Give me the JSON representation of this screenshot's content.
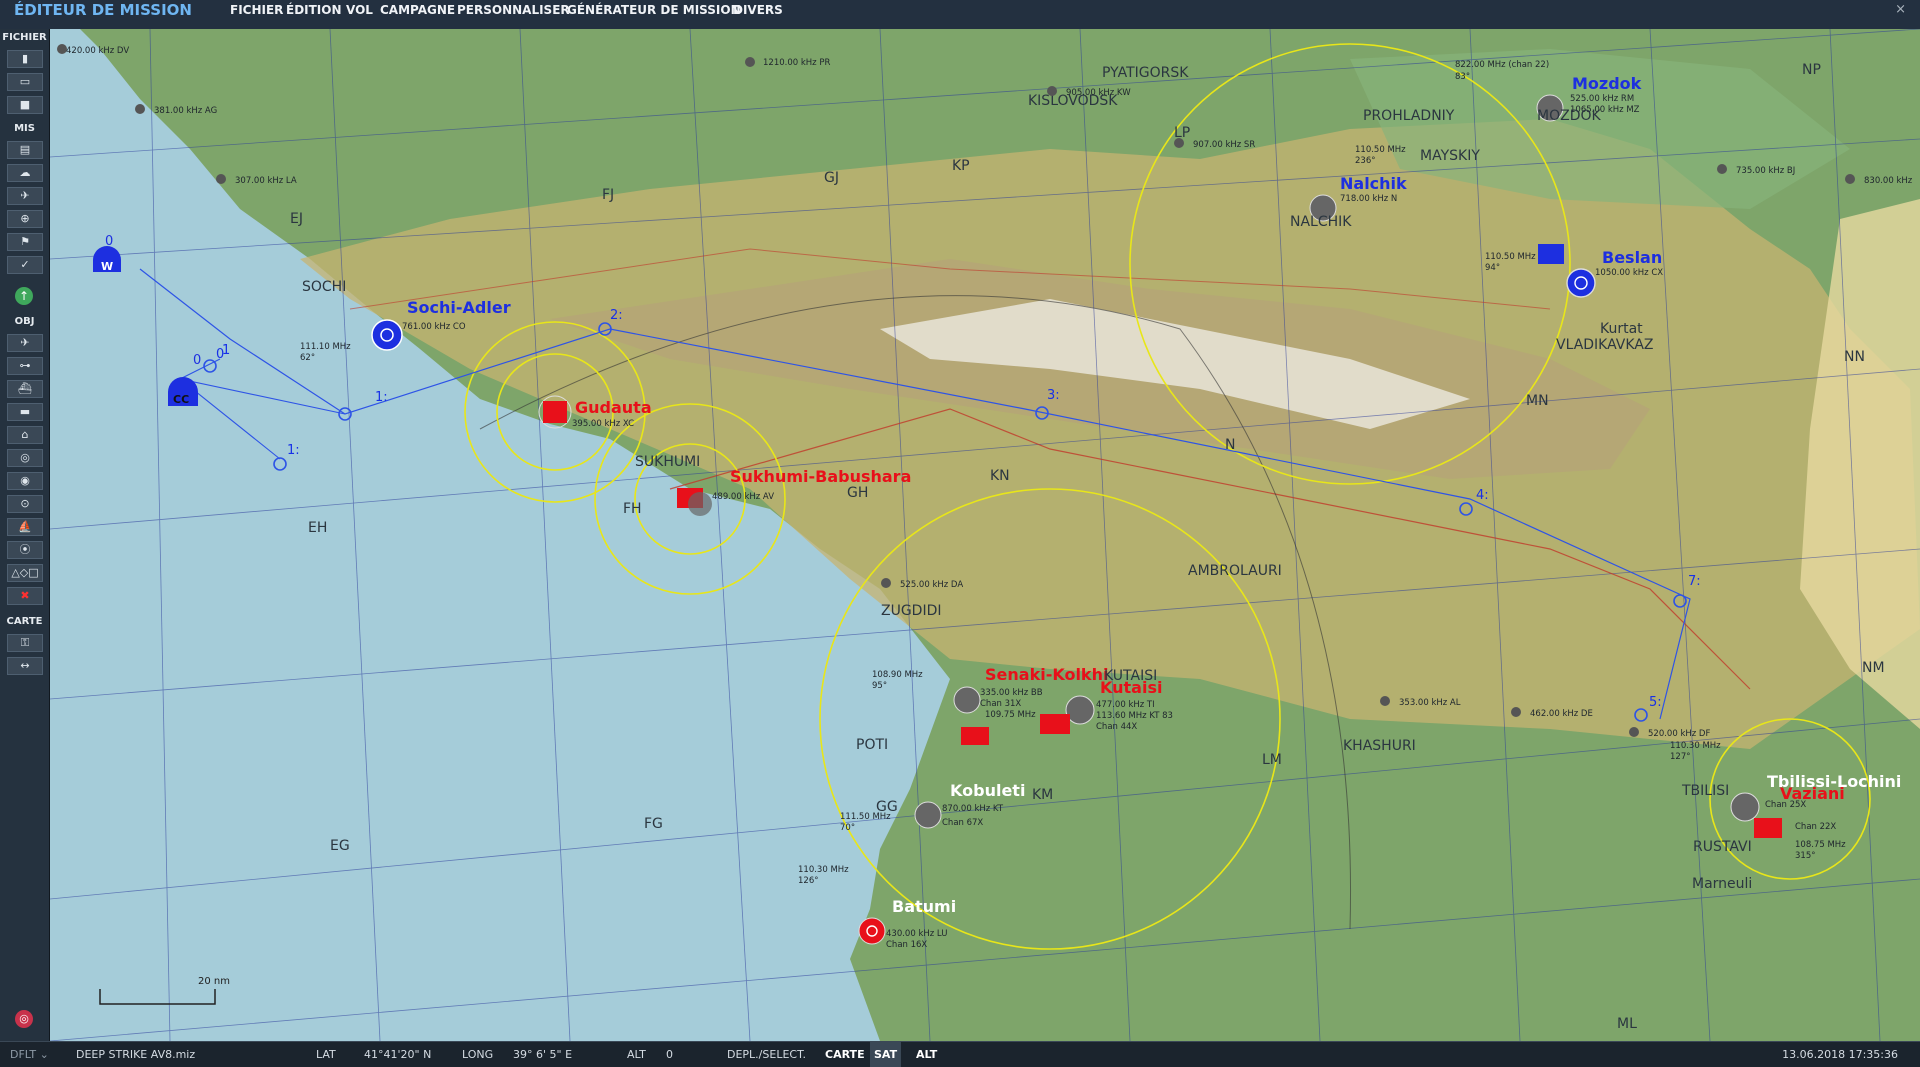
{
  "app": {
    "title": "ÉDITEUR DE MISSION",
    "close": "×"
  },
  "menu": [
    "FICHIER",
    "ÉDITION",
    "VOL",
    "CAMPAGNE",
    "PERSONNALISER",
    "GÉNÉRATEUR DE MISSION",
    "DIVERS"
  ],
  "toolbar": {
    "sections": {
      "file": "FICHIER",
      "mission": "MIS",
      "objects": "OBJ",
      "map": "CARTE"
    }
  },
  "map": {
    "scale_label": "20 nm",
    "bases": [
      {
        "name": "Sochi-Adler",
        "coalition": "blue",
        "beacon": "761.00 kHz CO",
        "ils": "111.10 MHz",
        "heading": "62°"
      },
      {
        "name": "Gudauta",
        "coalition": "red",
        "beacon": "395.00 kHz XC"
      },
      {
        "name": "Sukhumi-Babushara",
        "coalition": "red",
        "beacon": "489.00 kHz AV"
      },
      {
        "name": "Senaki-Kolkhi",
        "coalition": "red",
        "beacon": "335.00 kHz BB",
        "ils": "108.90 MHz",
        "heading": "95°",
        "tacan": "Chan 31X"
      },
      {
        "name": "Kutaisi",
        "coalition": "red",
        "beacon": "477.00 kHz TI",
        "ils": "109.75 MHz",
        "tacan": "Chan 44X",
        "vor": "113.60 MHz KT 83"
      },
      {
        "name": "Kobuleti",
        "coalition": "white",
        "beacon": "870.00 kHz KT",
        "ils": "111.50 MHz",
        "heading": "70°",
        "tacan": "Chan 67X"
      },
      {
        "name": "Batumi",
        "coalition": "white",
        "beacon": "430.00 kHz LU",
        "ils": "110.30 MHz",
        "heading": "126°",
        "tacan": "Chan 16X"
      },
      {
        "name": "Mozdok",
        "coalition": "blue",
        "beacon": "525.00 kHz RM",
        "ils": "822.00 MHz (chan 22)",
        "heading": "83°",
        "vor": "1065.00 kHz MZ"
      },
      {
        "name": "Nalchik",
        "coalition": "blue",
        "ils": "110.50 MHz",
        "heading": "236°",
        "beacon": "718.00 kHz N"
      },
      {
        "name": "Beslan",
        "coalition": "blue",
        "ils": "110.50 MHz",
        "heading": "94°",
        "beacon": "1050.00 kHz CX"
      },
      {
        "name": "Tbilissi-Lochini",
        "coalition": "white",
        "ils": "110.30 MHz",
        "heading": "127°",
        "tacan": "Chan 25X"
      },
      {
        "name": "Vaziani",
        "coalition": "red",
        "ils": "108.75 MHz",
        "heading": "315°",
        "tacan": "Chan 22X"
      }
    ],
    "cities": [
      "PYATIGORSK",
      "KISLOVODSK",
      "PROHLADNIY",
      "MAYSKIY",
      "NALCHIK",
      "VLADIKAVKAZ",
      "Kurtat",
      "SOCHI",
      "SUKHUMI",
      "ZUGDIDI",
      "KUTAISI",
      "AMBROLAURI",
      "POTI",
      "KHASHURI",
      "TBILISI",
      "RUSTAVI",
      "Marneuli",
      "MOZDOK"
    ],
    "grid": [
      "EJ",
      "FJ",
      "GJ",
      "KP",
      "LP",
      "NP",
      "EH",
      "FH",
      "GH",
      "KN",
      "MN",
      "NN",
      "N",
      "NM",
      "EG",
      "FG",
      "GG",
      "KM",
      "LM",
      "ML"
    ],
    "beacons": [
      "420.00 kHz DV",
      "1210.00 kHz PR",
      "381.00 kHz AG",
      "307.00 kHz LA",
      "905.00 kHz KW",
      "907.00 kHz SR",
      "735.00 kHz BJ",
      "830.00 kHz",
      "525.00 kHz DA",
      "353.00 kHz AL",
      "462.00 kHz DE",
      "520.00 kHz DF"
    ],
    "waypoints": [
      "0",
      "1",
      "1:",
      "1:",
      "2:",
      "3:",
      "4:",
      "5:",
      "7:"
    ],
    "markers": {
      "awacs": "W",
      "carrier": "CC",
      "awacs_wp": "0",
      "carrier_wp": "0"
    }
  },
  "status": {
    "profile": "DFLT",
    "mission_file": "DEEP STRIKE AV8.miz",
    "lat_label": "LAT",
    "lat": "41°41'20\" N",
    "long_label": "LONG",
    "long": "39° 6' 5\" E",
    "alt_label": "ALT",
    "alt": "0",
    "mode": "DEPL./SELECT.",
    "views": [
      "CARTE",
      "SAT",
      "ALT"
    ],
    "datetime": "13.06.2018 17:35:36"
  },
  "colors": {
    "blue": "#1d2fe0",
    "red": "#e8101a",
    "route": "#2e54e6",
    "range": "#e8e619",
    "sea": "#a5ccd9",
    "land": "#7ea56a"
  }
}
